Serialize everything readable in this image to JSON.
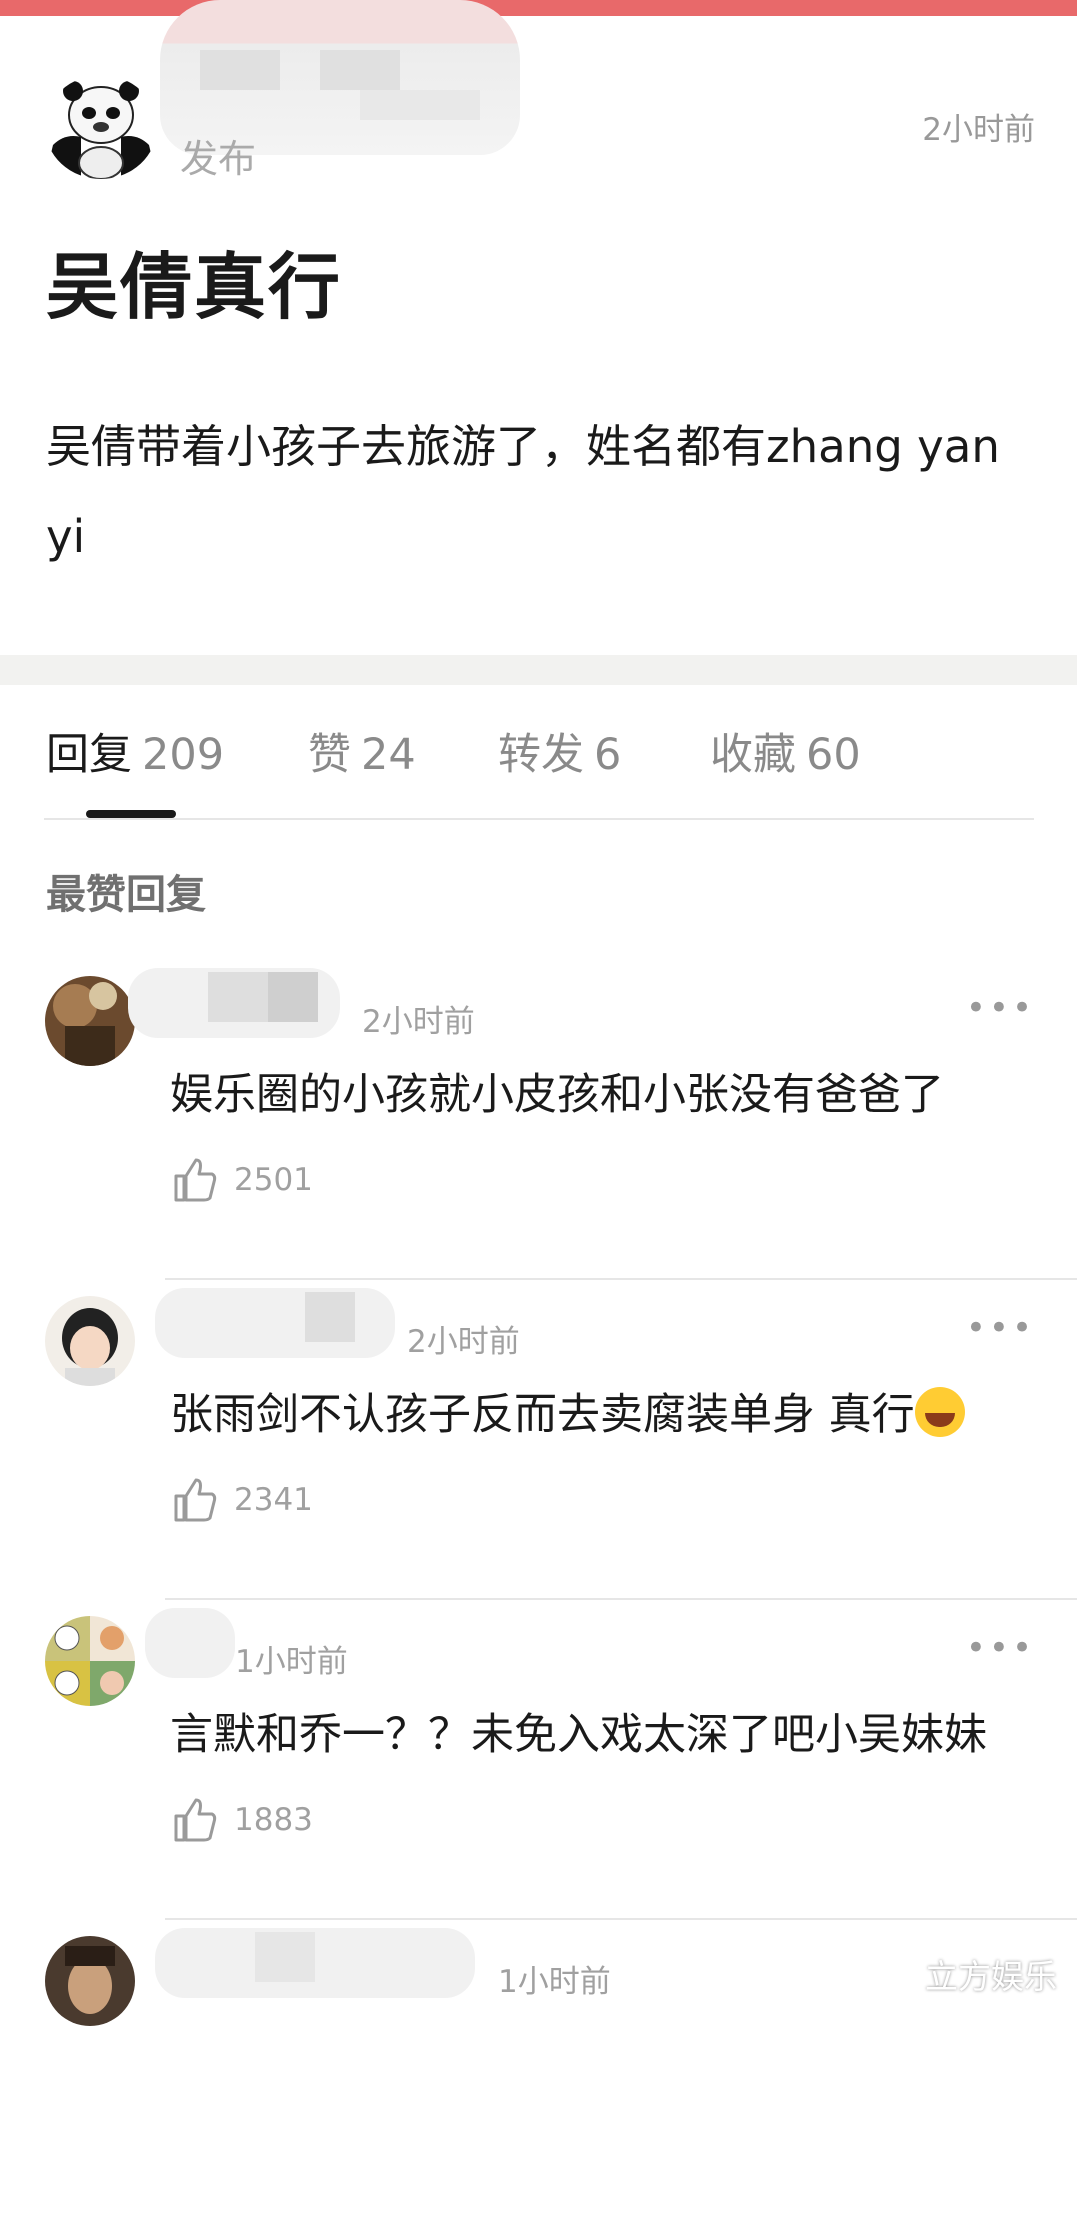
{
  "post": {
    "author_subtitle": "发布",
    "time": "2小时前",
    "title": "吴倩真行",
    "body": "吴倩带着小孩子去旅游了，姓名都有zhang yan yi"
  },
  "tabs": [
    {
      "label": "回复",
      "count": "209",
      "active": true
    },
    {
      "label": "赞",
      "count": "24",
      "active": false
    },
    {
      "label": "转发",
      "count": "6",
      "active": false
    },
    {
      "label": "收藏",
      "count": "60",
      "active": false
    }
  ],
  "section_title": "最赞回复",
  "comments": [
    {
      "time": "2小时前",
      "text": "娱乐圈的小孩就小皮孩和小张没有爸爸了",
      "likes": "2501",
      "more": "•••"
    },
    {
      "time": "2小时前",
      "text": "张雨剑不认孩子反而去卖腐装单身 真行",
      "likes": "2341",
      "more": "•••",
      "emoji": "grinning-face"
    },
    {
      "time": "1小时前",
      "text": "言默和乔一？？未免入戏太深了吧小吴妹妹",
      "likes": "1883",
      "more": "•••"
    },
    {
      "time": "1小时前",
      "text": "",
      "likes": "",
      "more": ""
    }
  ],
  "watermark": "立方娱乐",
  "colors": {
    "top_bar": "#e8696a",
    "active_tab": "#1a1a1a",
    "muted": "#a0a0a0"
  }
}
